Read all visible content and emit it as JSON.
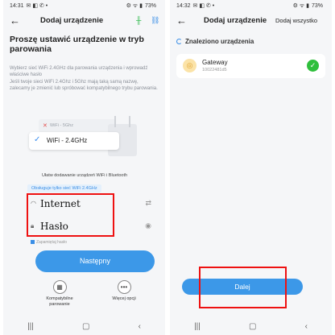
{
  "left": {
    "status": {
      "time": "14:31",
      "battery": "73%"
    },
    "title": "Dodaj urządzenie",
    "heading": "Proszę ustawić urządzenie w tryb parowania",
    "desc1": "Wybierz sieć WiFi 2.4GHz dla parowania urządzenia i wprowadź właściwe hasło",
    "desc2": "Jeśli twoje sieci WiFi 2.4Ghz i 5Ghz mają taką samą nazwę, zalecamy je zmienić lub spróbować kompatybilnego trybu parowania.",
    "wifi_5g": "WiFi - 5Ghz",
    "wifi_24g": "WiFi - 2.4GHz",
    "caption": "Ułatw dodawanie urządzeń WiFi i Bluetooth",
    "badge": "Obsługuje tylko sieć WiFi 2.4GHz",
    "network_value": "Internet",
    "password_value": "Hasło",
    "remember_label": "Zapamiętaj hasło",
    "next_button": "Następny",
    "compat_label": "Kompatybilne parowanie",
    "more_label": "Więcej opcji"
  },
  "right": {
    "status": {
      "time": "14:32",
      "battery": "73%"
    },
    "title": "Dodaj urządzenie",
    "add_all": "Dodaj wszystko",
    "found_label": "Znaleziono urządzenia",
    "device": {
      "name": "Gateway",
      "id": "10022481d5"
    },
    "next_button": "Dalej"
  },
  "colors": {
    "accent": "#3c98e8",
    "highlight": "#e11111",
    "success": "#2fbf3c"
  }
}
